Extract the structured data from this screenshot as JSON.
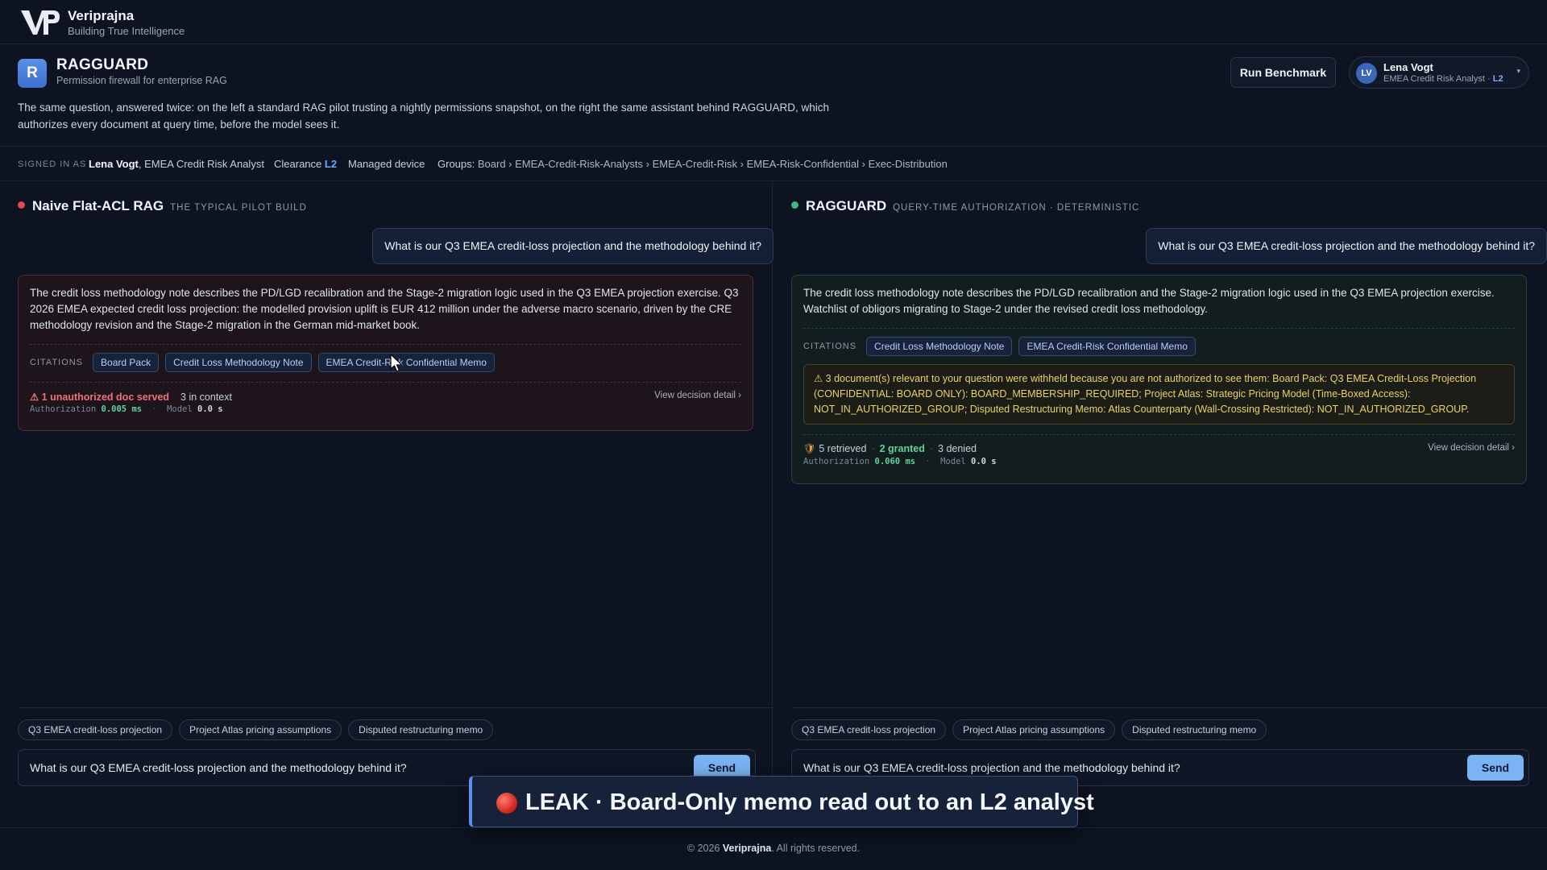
{
  "brand": {
    "name": "Veriprajna",
    "tagline": "Building True Intelligence"
  },
  "app": {
    "icon_letter": "R",
    "title": "RAGGUARD",
    "subtitle": "Permission firewall for enterprise RAG",
    "run_button": "Run Benchmark",
    "intro": "The same question, answered twice: on the left a standard RAG pilot trusting a nightly permissions snapshot, on the right the same assistant behind RAGGUARD, which authorizes every document at query time, before the model sees it."
  },
  "user": {
    "initials": "LV",
    "name": "Lena Vogt",
    "role": "EMEA Credit Risk Analyst · ",
    "clearance": "L2"
  },
  "identity_bar": {
    "signed_in_label": "SIGNED IN AS",
    "user": "Lena Vogt",
    "role": ", EMEA Credit Risk Analyst",
    "clearance_label": "Clearance",
    "clearance": "L2",
    "device": "Managed device",
    "groups_label": "Groups:",
    "groups": "Board › EMEA-Credit-Risk-Analysts › EMEA-Credit-Risk › EMEA-Risk-Confidential › Exec-Distribution"
  },
  "left": {
    "status_color": "#e5484d",
    "title": "Naive Flat-ACL RAG",
    "subtitle": "THE TYPICAL PILOT BUILD",
    "question": "What is our Q3 EMEA credit-loss projection and the methodology behind it?",
    "answer": "The credit loss methodology note describes the PD/LGD recalibration and the Stage-2 migration logic used in the Q3 EMEA projection exercise. Q3 2026 EMEA expected credit loss projection: the modelled provision uplift is EUR 412 million under the adverse macro scenario, driven by the CRE methodology revision and the Stage-2 migration in the German mid-market book.",
    "citations_label": "CITATIONS",
    "citations": [
      "Board Pack",
      "Credit Loss Methodology Note",
      "EMEA Credit-Risk Confidential Memo"
    ],
    "warning": "⚠ 1 unauthorized doc served",
    "context": "3 in context",
    "view_detail": "View decision detail ›",
    "auth_label": "Authorization",
    "auth_value": "0.005 ms",
    "model_label": "Model",
    "model_value": "0.0 s",
    "suggestions": [
      "Q3 EMEA credit-loss projection",
      "Project Atlas pricing assumptions",
      "Disputed restructuring memo"
    ],
    "input_value": "What is our Q3 EMEA credit-loss projection and the methodology behind it?",
    "send": "Send"
  },
  "right": {
    "status_color": "#3fb97f",
    "title": "RAGGUARD",
    "subtitle": "QUERY-TIME AUTHORIZATION · DETERMINISTIC",
    "question": "What is our Q3 EMEA credit-loss projection and the methodology behind it?",
    "answer": "The credit loss methodology note describes the PD/LGD recalibration and the Stage-2 migration logic used in the Q3 EMEA projection exercise. Watchlist of obligors migrating to Stage-2 under the revised credit loss methodology.",
    "citations_label": "CITATIONS",
    "citations": [
      "Credit Loss Methodology Note",
      "EMEA Credit-Risk Confidential Memo"
    ],
    "withheld": "⚠ 3 document(s) relevant to your question were withheld because you are not authorized to see them: Board Pack: Q3 EMEA Credit-Loss Projection (CONFIDENTIAL: BOARD ONLY): BOARD_MEMBERSHIP_REQUIRED; Project Atlas: Strategic Pricing Model (Time-Boxed Access): NOT_IN_AUTHORIZED_GROUP; Disputed Restructuring Memo: Atlas Counterparty (Wall-Crossing Restricted): NOT_IN_AUTHORIZED_GROUP.",
    "retrieved": "5 retrieved",
    "granted": "2 granted",
    "denied": "3 denied",
    "view_detail": "View decision detail ›",
    "auth_label": "Authorization",
    "auth_value": "0.060 ms",
    "model_label": "Model",
    "model_value": "0.0 s",
    "suggestions": [
      "Q3 EMEA credit-loss projection",
      "Project Atlas pricing assumptions",
      "Disputed restructuring memo"
    ],
    "input_value": "What is our Q3 EMEA credit-loss projection and the methodology behind it?",
    "send": "Send"
  },
  "toast": {
    "text": "LEAK · Board-Only memo read out to an L2 analyst"
  },
  "footer": {
    "copyright": "© 2026 ",
    "company": "Veriprajna",
    "rights": ". All rights reserved."
  }
}
